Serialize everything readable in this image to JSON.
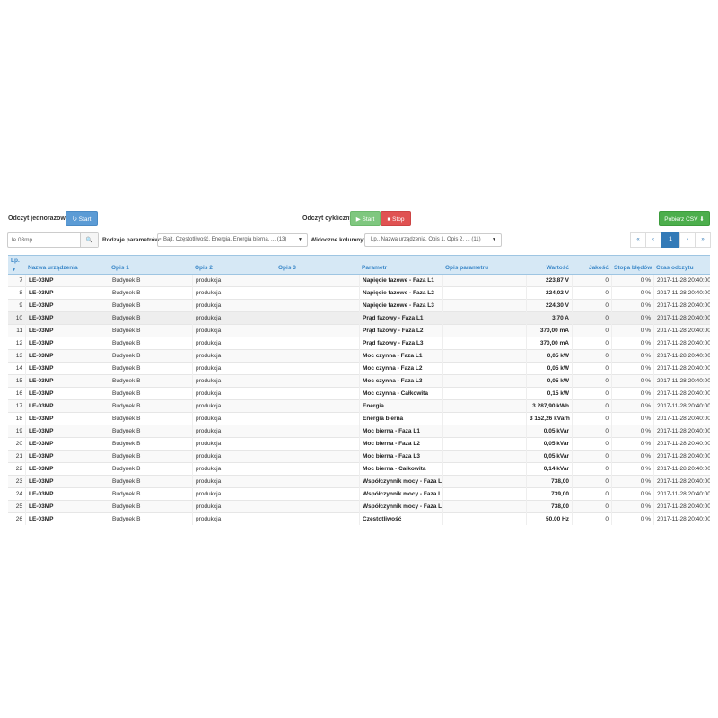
{
  "toolbar": {
    "single_read_label": "Odczyt jednorazowy:",
    "single_start": "↻ Start",
    "cyclic_read_label": "Odczyt cykliczny:",
    "cyclic_start": "▶ Start",
    "cyclic_stop": "■ Stop",
    "csv_button": "Pobierz CSV ⬇"
  },
  "filters": {
    "search_value": "le 03mp",
    "search_icon": "🔍",
    "param_types_label": "Rodzaje parametrów:",
    "param_types_value": "Bajt, Częstotliwość, Energia, Energia bierna, ... (13)",
    "visible_columns_label": "Widoczne kolumny:",
    "visible_columns_value": "Lp., Nazwa urządzenia, Opis 1, Opis 2, ... (11)"
  },
  "pagination": {
    "first": "«",
    "prev": "‹",
    "current": "1",
    "next": "›",
    "last": "»"
  },
  "table": {
    "headers": [
      "Lp.",
      "Nazwa urządzenia",
      "Opis 1",
      "Opis 2",
      "Opis 3",
      "Parametr",
      "Opis parametru",
      "Wartość",
      "Jakość",
      "Stopa błędów",
      "Czas odczytu"
    ],
    "rows": [
      [
        "7",
        "LE-03MP",
        "Budynek B",
        "produkcja",
        "",
        "Napięcie fazowe - Faza L1",
        "",
        "223,87 V",
        "0",
        "0 %",
        "2017-11-28 20:40:00"
      ],
      [
        "8",
        "LE-03MP",
        "Budynek B",
        "produkcja",
        "",
        "Napięcie fazowe - Faza L2",
        "",
        "224,02 V",
        "0",
        "0 %",
        "2017-11-28 20:40:00"
      ],
      [
        "9",
        "LE-03MP",
        "Budynek B",
        "produkcja",
        "",
        "Napięcie fazowe - Faza L3",
        "",
        "224,30 V",
        "0",
        "0 %",
        "2017-11-28 20:40:00"
      ],
      [
        "10",
        "LE-03MP",
        "Budynek B",
        "produkcja",
        "",
        "Prąd fazowy - Faza L1",
        "",
        "3,70 A",
        "0",
        "0 %",
        "2017-11-28 20:40:00"
      ],
      [
        "11",
        "LE-03MP",
        "Budynek B",
        "produkcja",
        "",
        "Prąd fazowy - Faza L2",
        "",
        "370,00 mA",
        "0",
        "0 %",
        "2017-11-28 20:40:00"
      ],
      [
        "12",
        "LE-03MP",
        "Budynek B",
        "produkcja",
        "",
        "Prąd fazowy - Faza L3",
        "",
        "370,00 mA",
        "0",
        "0 %",
        "2017-11-28 20:40:00"
      ],
      [
        "13",
        "LE-03MP",
        "Budynek B",
        "produkcja",
        "",
        "Moc czynna - Faza L1",
        "",
        "0,05 kW",
        "0",
        "0 %",
        "2017-11-28 20:40:00"
      ],
      [
        "14",
        "LE-03MP",
        "Budynek B",
        "produkcja",
        "",
        "Moc czynna - Faza L2",
        "",
        "0,05 kW",
        "0",
        "0 %",
        "2017-11-28 20:40:00"
      ],
      [
        "15",
        "LE-03MP",
        "Budynek B",
        "produkcja",
        "",
        "Moc czynna - Faza L3",
        "",
        "0,05 kW",
        "0",
        "0 %",
        "2017-11-28 20:40:00"
      ],
      [
        "16",
        "LE-03MP",
        "Budynek B",
        "produkcja",
        "",
        "Moc czynna - Całkowita",
        "",
        "0,15 kW",
        "0",
        "0 %",
        "2017-11-28 20:40:00"
      ],
      [
        "17",
        "LE-03MP",
        "Budynek B",
        "produkcja",
        "",
        "Energia",
        "",
        "3 287,90 kWh",
        "0",
        "0 %",
        "2017-11-28 20:40:00"
      ],
      [
        "18",
        "LE-03MP",
        "Budynek B",
        "produkcja",
        "",
        "Energia bierna",
        "",
        "3 152,26 kVarh",
        "0",
        "0 %",
        "2017-11-28 20:40:00"
      ],
      [
        "19",
        "LE-03MP",
        "Budynek B",
        "produkcja",
        "",
        "Moc bierna - Faza L1",
        "",
        "0,05 kVar",
        "0",
        "0 %",
        "2017-11-28 20:40:00"
      ],
      [
        "20",
        "LE-03MP",
        "Budynek B",
        "produkcja",
        "",
        "Moc bierna - Faza L2",
        "",
        "0,05 kVar",
        "0",
        "0 %",
        "2017-11-28 20:40:00"
      ],
      [
        "21",
        "LE-03MP",
        "Budynek B",
        "produkcja",
        "",
        "Moc bierna - Faza L3",
        "",
        "0,05 kVar",
        "0",
        "0 %",
        "2017-11-28 20:40:00"
      ],
      [
        "22",
        "LE-03MP",
        "Budynek B",
        "produkcja",
        "",
        "Moc bierna - Całkowita",
        "",
        "0,14 kVar",
        "0",
        "0 %",
        "2017-11-28 20:40:00"
      ],
      [
        "23",
        "LE-03MP",
        "Budynek B",
        "produkcja",
        "",
        "Współczynnik mocy - Faza L1",
        "",
        "738,00",
        "0",
        "0 %",
        "2017-11-28 20:40:00"
      ],
      [
        "24",
        "LE-03MP",
        "Budynek B",
        "produkcja",
        "",
        "Współczynnik mocy - Faza L2",
        "",
        "739,00",
        "0",
        "0 %",
        "2017-11-28 20:40:00"
      ],
      [
        "25",
        "LE-03MP",
        "Budynek B",
        "produkcja",
        "",
        "Współczynnik mocy - Faza L3",
        "",
        "738,00",
        "0",
        "0 %",
        "2017-11-28 20:40:00"
      ],
      [
        "26",
        "LE-03MP",
        "Budynek B",
        "produkcja",
        "",
        "Częstotliwość",
        "",
        "50,00 Hz",
        "0",
        "0 %",
        "2017-11-28 20:40:00"
      ]
    ]
  }
}
